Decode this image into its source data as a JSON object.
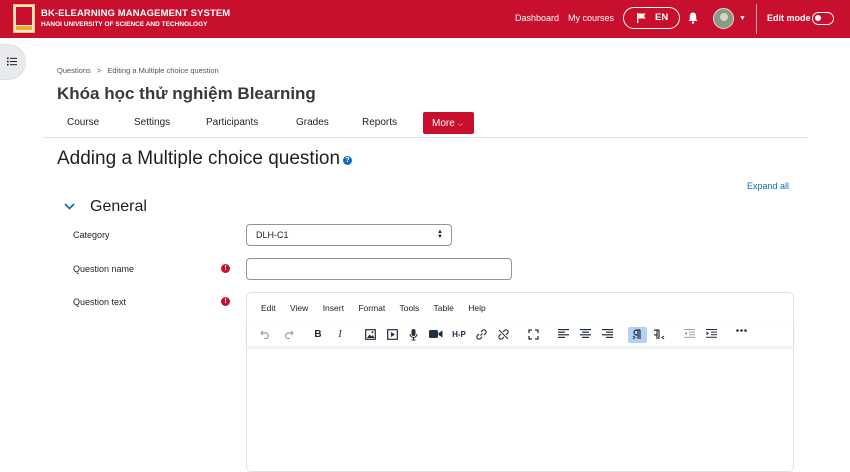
{
  "navbar": {
    "brand_title": "BK-ELEARNING MANAGEMENT SYSTEM",
    "brand_subtitle": "HANOI UNIVERSITY OF SCIENCE AND TECHNOLOGY",
    "links": [
      "Dashboard",
      "My courses"
    ],
    "language": "EN",
    "edit_mode_label": "Edit mode",
    "accent_color": "#c8102e"
  },
  "breadcrumb": [
    "Questions",
    ">",
    "Editing a Multiple choice question"
  ],
  "course_title": "Khóa học thử nghiệm Blearning",
  "secondary_nav": {
    "items": [
      "Course",
      "Settings",
      "Participants",
      "Grades",
      "Reports"
    ],
    "more_label": "More"
  },
  "page_heading": "Adding a Multiple choice question",
  "expand_all": "Expand all",
  "section": {
    "title": "General"
  },
  "form": {
    "category_label": "Category",
    "category_value": "DLH-C1",
    "question_name_label": "Question name",
    "question_name_value": "",
    "question_text_label": "Question text"
  },
  "editor": {
    "menu": [
      "Edit",
      "View",
      "Insert",
      "Format",
      "Tools",
      "Table",
      "Help"
    ],
    "toolbar_icons": [
      "undo-icon",
      "redo-icon",
      "bold-icon",
      "italic-icon",
      "image-icon",
      "media-icon",
      "microphone-icon",
      "video-icon",
      "h5p-icon",
      "link-icon",
      "unlink-icon",
      "fullscreen-icon",
      "align-left-icon",
      "align-center-icon",
      "align-right-icon",
      "ltr-icon",
      "rtl-icon",
      "outdent-icon",
      "indent-icon",
      "more-icon"
    ],
    "h5p_label": "H-P",
    "bold_label": "B",
    "italic_label": "I"
  }
}
